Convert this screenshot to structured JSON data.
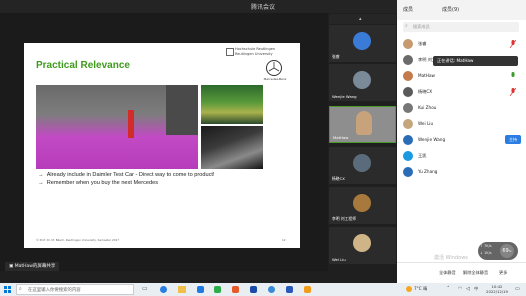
{
  "window": {
    "title": "腾讯会议"
  },
  "slide": {
    "title": "Practical Relevance",
    "school_line1": "Hochschule Reutlingen",
    "school_line2": "Reutlingen University",
    "brand": "Mercedes-Benz",
    "bullets": [
      "Already include in Daimler Test Car - Direct way to come to product!",
      "Remember when you buy the next Mercedes"
    ],
    "footer": "© Prof. Dr. M. Bäsch, Reutlingen University, Semester 2017",
    "page": "12"
  },
  "videos": [
    {
      "name": "张睿",
      "color": "#3b7bd8"
    },
    {
      "name": "Wenjie Wang",
      "color": "#7a8a99"
    },
    {
      "name": "MatHaw",
      "color": "#c8a27a"
    },
    {
      "name": "杨晓CX",
      "color": "#5a6c7c"
    },
    {
      "name": "李明 刘工程师",
      "color": "#a8793c"
    },
    {
      "name": "Wei Liu",
      "color": "#ceb487"
    }
  ],
  "sidebar": {
    "tab_members": "成员",
    "tab_chat": "成员(9)",
    "search_placeholder": "搜索成员",
    "toast": "正在讲话: MatHaw",
    "members": [
      {
        "name": "张睿",
        "color": "#c59a6f"
      },
      {
        "name": "李明 刘工程师",
        "color": "#6b6b6b"
      },
      {
        "name": "MatHaw",
        "color": "#c47a4a"
      },
      {
        "name": "杨晓CX",
        "color": "#5a5a5a"
      },
      {
        "name": "Kui Zhou",
        "color": "#777"
      },
      {
        "name": "Wei Liu",
        "color": "#c4a57e"
      },
      {
        "name": "Wenjie Wang",
        "color": "#2a6db5",
        "tag": "主持"
      },
      {
        "name": "王凯",
        "color": "#1a9ae0"
      },
      {
        "name": "Yu Zhang",
        "color": "#2a6db5"
      }
    ],
    "watermark": "激活 Windows",
    "mute_all": "全体静音",
    "unmute_all": "解除全体静音",
    "more": "更多"
  },
  "screen_owner": "MatHaw的屏幕共享",
  "speed": "69",
  "speed_unit": "%",
  "net_up": "↑ 7K/s",
  "net_down": "↓ 1K/s",
  "taskbar": {
    "search_placeholder": "在这里输入你要搜索的内容",
    "weather": "7°C 晴",
    "time": "10:42",
    "date": "2022/12/19"
  }
}
